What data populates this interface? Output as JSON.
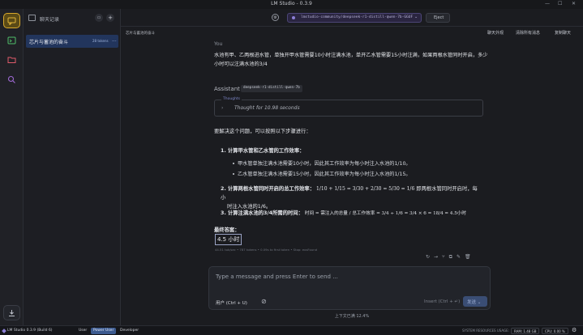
{
  "window": {
    "title": "LM Studio - 0.3.9"
  },
  "sidebar": {
    "header_label": "聊天记录",
    "chats": [
      {
        "name": "芯片与蓄池的奋斗",
        "tokens": "28 tokens",
        "more": "..."
      }
    ]
  },
  "topbar": {
    "model_path": "lmstudio-community/deepseek-r1-distill-qwen-7b-GGUF",
    "eject_label": "Eject"
  },
  "subbar": {
    "chat_title": "芯片与蓄池的奋斗",
    "links": [
      "聊天外观",
      "清除所有消息",
      "复制聊天"
    ]
  },
  "conversation": {
    "user_role": "You",
    "user_message": "水池有甲、乙两根进水管，单独开甲水管需要10小时注满水池，单开乙水管需要15小时注满，如果两根水管同时开启，多少小时可以注满水池的3/4",
    "assistant_role": "Assistant",
    "model_tag": "deepseek-r1-distill-qwen-7b",
    "thought_tag": "Thoughts",
    "thought_text": "Thought for 10.98 seconds",
    "intro": "要解决这个问题，可以按照以下步骤进行：",
    "step1_title": "1. 计算甲水管和乙水管的工作效率：",
    "step1_bullets": [
      "甲水管单独注满水池需要10小时，因此其工作效率为每小时注入水池的1/10。",
      "乙水管单独注满水池需要15小时，因此其工作效率为每小时注入水池的1/15。"
    ],
    "step2_title": "2. 计算两根水管同时开启的总工作效率：",
    "step2_formula": "1/10 + 1/15 = 3/30 + 2/30 = 5/30 = 1/6",
    "step2_text": "即两根水管同时开启时，每小",
    "step2_text2": "时注入水池的1/6。",
    "step3_title": "3. 计算注满水池的3/4所需的时间：",
    "step3_formula": "时间 = 需注入的总量 / 总工作效率 = 3/4 ÷ 1/6 = 3/4 × 6 = 18/4 = 4.5小时",
    "final_label": "最终答案：",
    "final_answer": "4.5 小时",
    "stats": "44.51 tok/sec • 787 tokens • 0.09s to first token • Stop: eosFound"
  },
  "composer": {
    "placeholder": "Type a message and press Enter to send ...",
    "user_btn": "用户 (Ctrl + U)",
    "insert_label": "Insert (Ctrl + ↵)",
    "send_label": "发送"
  },
  "context_usage": "上下文已满 12.4%",
  "statusbar": {
    "app": "LM Studio 0.3.9 (Build 6)",
    "modes": [
      "User",
      "Power User",
      "Developer"
    ],
    "system_label": "SYSTEM RESOURCES USAGE:",
    "ram": "RAM: 1.48 GB",
    "cpu": "CPU: 0.00 %"
  },
  "colors": {
    "accent": "#d9a92b",
    "selected": "#22355c",
    "mode_selected": "#3c5a8f"
  }
}
